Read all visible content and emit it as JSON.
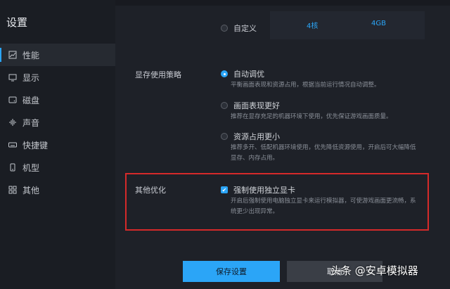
{
  "window": {
    "title": "设置"
  },
  "sidebar": {
    "items": [
      {
        "label": "性能",
        "icon": "performance-icon"
      },
      {
        "label": "显示",
        "icon": "monitor-icon"
      },
      {
        "label": "磁盘",
        "icon": "disk-icon"
      },
      {
        "label": "声音",
        "icon": "sound-icon"
      },
      {
        "label": "快捷键",
        "icon": "keyboard-icon"
      },
      {
        "label": "机型",
        "icon": "phone-icon"
      },
      {
        "label": "其他",
        "icon": "grid-icon"
      }
    ]
  },
  "performance": {
    "custom_label": "自定义",
    "cpu_value": "4核",
    "ram_value": "4GB"
  },
  "memory_strategy": {
    "label": "显存使用策略",
    "options": [
      {
        "label": "自动调优",
        "desc": "平衡画面表现和资源占用，根据当前运行情况自动调整。",
        "checked": true
      },
      {
        "label": "画面表现更好",
        "desc": "推荐在显存充足的机器环境下使用，优先保证游戏画面质量。",
        "checked": false
      },
      {
        "label": "资源占用更小",
        "desc": "推荐多开、低配机器环境使用，优先降低资源使用，开启后可大幅降低显存、内存占用。",
        "checked": false
      }
    ]
  },
  "other_optimization": {
    "label": "其他优化",
    "checkbox_label": "强制使用独立显卡",
    "checked": true,
    "desc": "开启后强制使用电脑独立显卡来运行模拟器，可使游戏画面更流畅，系统更少出现异常。"
  },
  "footer": {
    "save_label": "保存设置",
    "cancel_label": "取消"
  },
  "watermark": "头条 @安卓模拟器",
  "colors": {
    "accent": "#2ba5f7",
    "highlight": "#d52a2a"
  }
}
